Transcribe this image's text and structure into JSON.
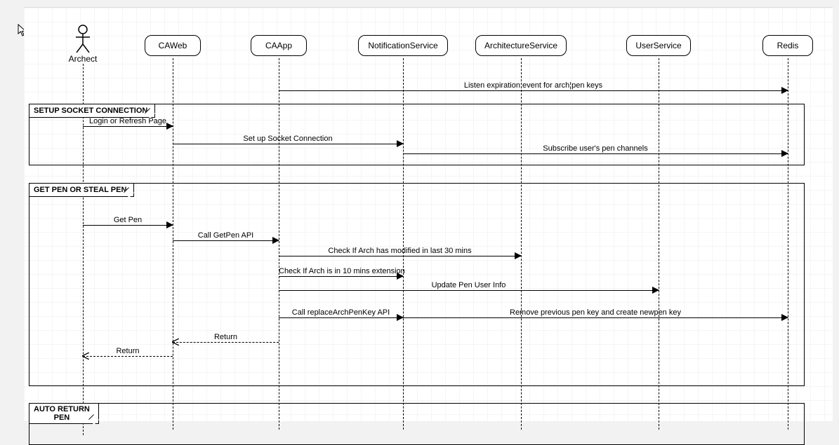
{
  "actor": {
    "name": "Archect"
  },
  "participants": {
    "caweb": "CAWeb",
    "caapp": "CAApp",
    "notification": "NotificationService",
    "archsvc": "ArchitectureService",
    "usersvc": "UserService",
    "redis": "Redis"
  },
  "fragments": {
    "setup": "SETUP SOCKET CONNECTION",
    "getpen": "GET PEN OR STEAL PEN",
    "autoreturn1": "AUTO RETURN",
    "autoreturn2": "PEN"
  },
  "messages": {
    "listen": "Listen expiration event for arch¦pen keys",
    "login": "Login or Refresh Page",
    "setup_socket": "Set up Socket Connection",
    "subscribe": "Subscribe user's pen channels",
    "getpen": "Get Pen",
    "getpenapi": "Call GetPen API",
    "check30": "Check If Arch has modified in last 30 mins",
    "check10": "Check If Arch is in 10 mins extension",
    "updatepen": "Update Pen User Info",
    "replacekey": "Call replaceArchPenKey API",
    "removeprev": "Remove previous pen key and create newpen key",
    "return1": "Return",
    "return2": "Return"
  },
  "chart_data": {
    "type": "sequence-diagram",
    "actor": "Archect",
    "participants": [
      "CAWeb",
      "CAApp",
      "NotificationService",
      "ArchitectureService",
      "UserService",
      "Redis"
    ],
    "messages": [
      {
        "from": "CAApp",
        "to": "Redis",
        "label": "Listen expiration event for arch¦pen keys",
        "style": "solid"
      }
    ],
    "fragments": [
      {
        "label": "SETUP SOCKET CONNECTION",
        "messages": [
          {
            "from": "Archect",
            "to": "CAWeb",
            "label": "Login or Refresh Page",
            "style": "solid"
          },
          {
            "from": "CAWeb",
            "to": "NotificationService",
            "label": "Set up Socket Connection",
            "style": "solid"
          },
          {
            "from": "NotificationService",
            "to": "Redis",
            "label": "Subscribe user's pen channels",
            "style": "solid"
          }
        ]
      },
      {
        "label": "GET PEN OR STEAL PEN",
        "messages": [
          {
            "from": "Archect",
            "to": "CAWeb",
            "label": "Get Pen",
            "style": "solid"
          },
          {
            "from": "CAWeb",
            "to": "CAApp",
            "label": "Call GetPen API",
            "style": "solid"
          },
          {
            "from": "CAApp",
            "to": "ArchitectureService",
            "label": "Check If Arch has modified in last 30 mins",
            "style": "solid"
          },
          {
            "from": "CAApp",
            "to": "NotificationService",
            "label": "Check If Arch is in 10 mins extension",
            "style": "solid"
          },
          {
            "from": "CAApp",
            "to": "UserService",
            "label": "Update Pen User Info",
            "style": "solid"
          },
          {
            "from": "CAApp",
            "to": "NotificationService",
            "label": "Call replaceArchPenKey API",
            "style": "solid"
          },
          {
            "from": "NotificationService",
            "to": "Redis",
            "label": "Remove previous pen key and create newpen key",
            "style": "solid"
          },
          {
            "from": "CAApp",
            "to": "CAWeb",
            "label": "Return",
            "style": "dashed"
          },
          {
            "from": "CAWeb",
            "to": "Archect",
            "label": "Return",
            "style": "dashed"
          }
        ]
      },
      {
        "label": "AUTO RETURN PEN",
        "messages": []
      }
    ]
  }
}
